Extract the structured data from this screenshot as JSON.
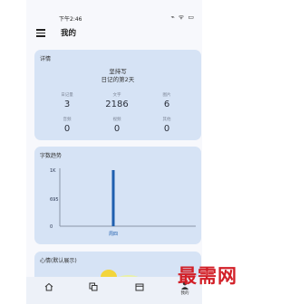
{
  "status_bar": {
    "time": "下午2:46",
    "icons": "⌁ ᯤ ▭"
  },
  "header": {
    "title": "我的"
  },
  "detail_card": {
    "title": "详情",
    "persist_label": "坚持写",
    "diary_days": "日记的第2天",
    "stats": [
      {
        "label": "日记量",
        "value": "3"
      },
      {
        "label": "文字",
        "value": "2186"
      },
      {
        "label": "图片",
        "value": "6"
      },
      {
        "label": "音频",
        "value": "0"
      },
      {
        "label": "视频",
        "value": "0"
      },
      {
        "label": "其他",
        "value": "0"
      }
    ]
  },
  "trend_card": {
    "title": "字数趋势",
    "chart_data": {
      "type": "bar",
      "categories": [
        "周四"
      ],
      "values": [
        2186
      ],
      "y_ticks": [
        "1K",
        "695",
        "0"
      ],
      "ylim": [
        0,
        2186
      ],
      "bar_color": "#1f5fae",
      "grid": false
    }
  },
  "mood_card": {
    "title": "心情(默认展示)"
  },
  "bottom_nav": {
    "items": [
      {
        "icon": "home-icon",
        "label": ""
      },
      {
        "icon": "copy-icon",
        "label": ""
      },
      {
        "icon": "calendar-icon",
        "label": ""
      },
      {
        "icon": "profile-icon",
        "label": "我的"
      }
    ]
  },
  "watermark": "最需网",
  "colors": {
    "card_bg": "#d6e3f5",
    "accent": "#1f5fae",
    "watermark": "#d21f27"
  }
}
